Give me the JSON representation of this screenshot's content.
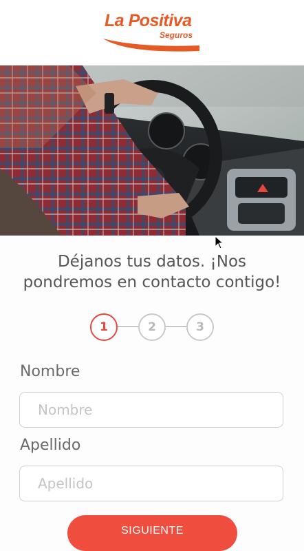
{
  "brand": {
    "name": "La Positiva",
    "tagline": "Seguros",
    "color": "#e65a25"
  },
  "hero": {
    "icon": "car-driver-photo"
  },
  "headline": {
    "line1": "Déjanos tus datos. ¡Nos",
    "line2": "pondremos en contacto contigo!"
  },
  "steps": [
    {
      "label": "1",
      "state": "active"
    },
    {
      "label": "2",
      "state": "inactive"
    },
    {
      "label": "3",
      "state": "inactive"
    }
  ],
  "form": {
    "nombre": {
      "label": "Nombre",
      "placeholder": "Nombre",
      "value": ""
    },
    "apellido": {
      "label": "Apellido",
      "placeholder": "Apellido",
      "value": ""
    }
  },
  "actions": {
    "next_label": "SIGUIENTE",
    "next_color": "#ef4d3e"
  }
}
